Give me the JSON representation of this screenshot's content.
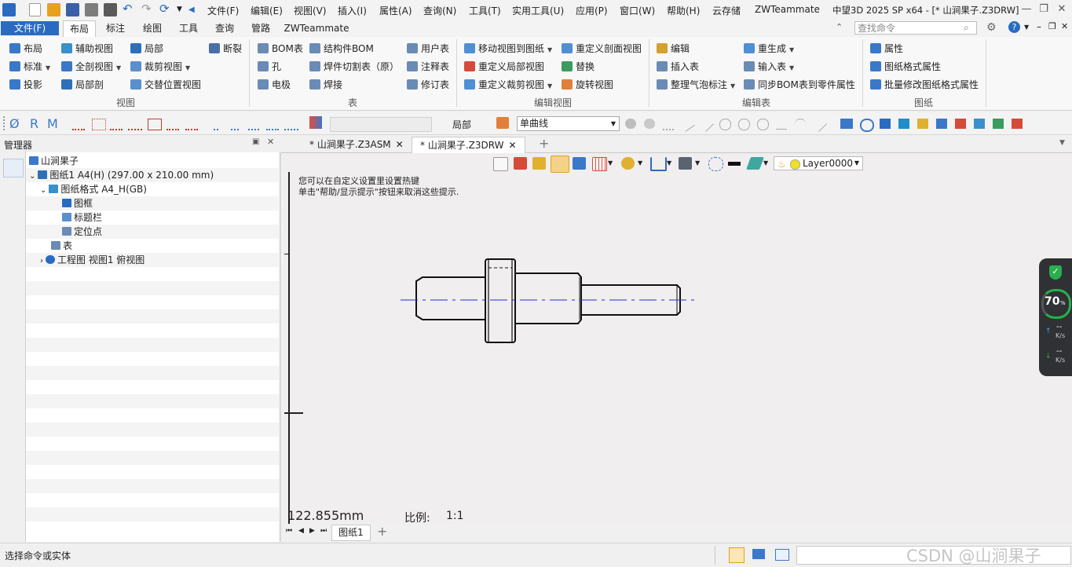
{
  "menubar": {
    "items": [
      "文件(F)",
      "编辑(E)",
      "视图(V)",
      "插入(I)",
      "属性(A)",
      "查询(N)",
      "工具(T)",
      "实用工具(U)",
      "应用(P)",
      "窗口(W)",
      "帮助(H)",
      "云存储",
      "ZWTeammate"
    ],
    "window_title": "中望3D 2025 SP x64 - [* 山涧果子.Z3DRW]"
  },
  "ribbon_tabs": {
    "file": "文件(F)",
    "tabs": [
      "布局",
      "标注",
      "绘图",
      "工具",
      "查询",
      "管路",
      "ZWTeammate"
    ],
    "active": "布局",
    "search_placeholder": "查找命令"
  },
  "ribbon": {
    "view_group": {
      "label": "视图",
      "buttons": [
        "布局",
        "辅助视图",
        "局部",
        "断裂",
        "标准",
        "全剖视图",
        "裁剪视图",
        "投影",
        "局部剖",
        "交替位置视图"
      ]
    },
    "table_group": {
      "label": "表",
      "buttons": [
        "BOM表",
        "结构件BOM",
        "用户表",
        "孔",
        "焊件切割表（原）",
        "注释表",
        "电极",
        "焊接",
        "修订表"
      ]
    },
    "edit_view_group": {
      "label": "编辑视图",
      "buttons": [
        "移动视图到图纸",
        "重定义剖面视图",
        "重定义局部视图",
        "替换",
        "重定义裁剪视图",
        "旋转视图"
      ]
    },
    "edit_table_group": {
      "label": "编辑表",
      "buttons": [
        "编辑",
        "重生成",
        "插入表",
        "输入表",
        "整理气泡标注",
        "同步BOM表到零件属性"
      ]
    },
    "sheet_group": {
      "label": "图纸",
      "buttons": [
        "属性",
        "图纸格式属性",
        "批量修改图纸格式属性"
      ]
    }
  },
  "toolbar": {
    "scope_label": "局部",
    "linetype_value": "单曲线",
    "dim_glyphs": [
      "Ø",
      "R",
      "M"
    ]
  },
  "manager": {
    "title": "管理器",
    "tree": [
      {
        "label": "山涧果子",
        "level": 0
      },
      {
        "label": "图纸1 A4(H) (297.00 x 210.00 mm)",
        "level": 1
      },
      {
        "label": "图纸格式 A4_H(GB)",
        "level": 2
      },
      {
        "label": "图框",
        "level": 3
      },
      {
        "label": "标题栏",
        "level": 3
      },
      {
        "label": "定位点",
        "level": 3
      },
      {
        "label": "表",
        "level": 2
      },
      {
        "label": "工程图 视图1 俯视图",
        "level": 2
      }
    ]
  },
  "doc_tabs": [
    {
      "label": "* 山涧果子.Z3ASM",
      "active": false
    },
    {
      "label": "* 山涧果子.Z3DRW",
      "active": true
    }
  ],
  "canvas": {
    "layer": "Layer0000",
    "hint1": "您可以在自定义设置里设置热键",
    "hint2": "单击\"帮助/显示提示\"按钮来取消这些提示.",
    "measure": "122.855mm",
    "scale_label": "比例:",
    "scale_value": "1:1"
  },
  "sheet_tabs": [
    "图纸1"
  ],
  "status": {
    "prompt": "选择命令或实体",
    "watermark": "CSDN @山涧果子"
  },
  "net_widget": {
    "percent": "70",
    "percent_unit": "%",
    "up_value": "--",
    "down_value": "--",
    "unit": "K/s"
  },
  "colors": {
    "accent": "#2a6bc2",
    "centerline": "#1f2fd0",
    "widget_ring": "#27b04b"
  }
}
